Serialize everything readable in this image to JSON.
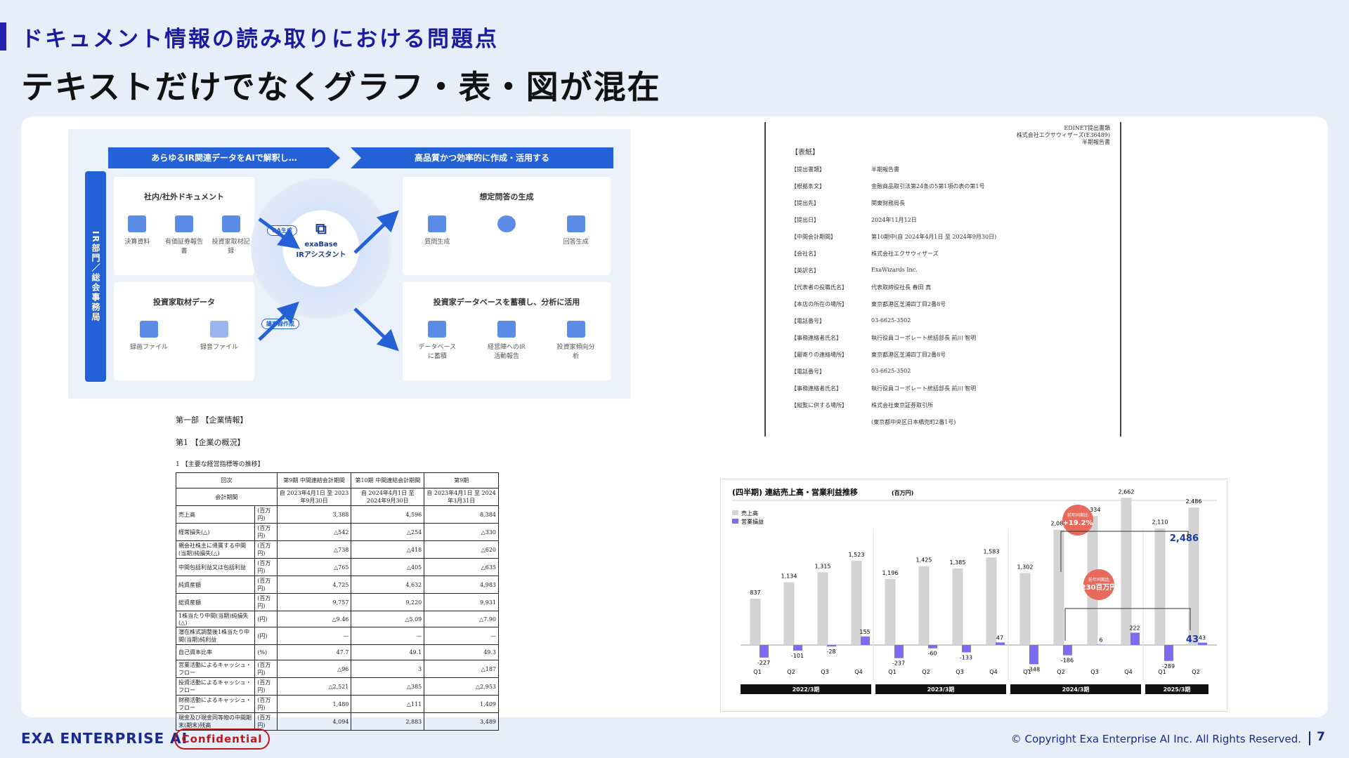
{
  "slide": {
    "subtitle": "ドキュメント情報の読み取りにおける問題点",
    "title": "テキストだけでなくグラフ・表・図が混在",
    "page": "7"
  },
  "footer": {
    "logo": "EXA ENTERPRISE AI",
    "confidential": "Confidential",
    "copyright": "© Copyright Exa Enterprise AI Inc. All Rights Reserved."
  },
  "diagram": {
    "banner_left": "あらゆるIR関連データをAIで解釈し…",
    "banner_right": "高品質かつ効率的に作成・活用する",
    "side_label": "IR部門／総会事務局",
    "box1_title": "社内/社外ドキュメント",
    "box1_items": [
      "決算資料",
      "有価証券報告書",
      "投資家取材記録"
    ],
    "box2_title": "投資家取材データ",
    "box2_items": [
      "録画ファイル",
      "録音ファイル"
    ],
    "box3_title": "想定問答の生成",
    "box3_items": [
      "質問生成",
      "回答生成"
    ],
    "box4_title": "投資家データベースを蓄積し、分析に活用",
    "box4_items": [
      "データベースに蓄積",
      "経営陣へのIR活動報告",
      "投資家傾向分析"
    ],
    "center_brand": "exaBase",
    "center_sub": "IRアシスタント",
    "pill_qa": "QA生成",
    "pill_minutes": "議事録作成"
  },
  "doc": {
    "header": [
      "EDINET提出書類",
      "株式会社エクサウィザーズ(E36489)",
      "半期報告書"
    ],
    "section": "【表紙】",
    "rows": [
      [
        "【提出書類】",
        "半期報告書"
      ],
      [
        "【根拠条文】",
        "金融商品取引法第24条の5第1項の表の第1号"
      ],
      [
        "【提出先】",
        "関東財務局長"
      ],
      [
        "【提出日】",
        "2024年11月12日"
      ],
      [
        "【中間会計期間】",
        "第10期中(自 2024年4月1日 至 2024年9月30日)"
      ],
      [
        "【会社名】",
        "株式会社エクサウィザーズ"
      ],
      [
        "【英訳名】",
        "ExaWizards Inc."
      ],
      [
        "【代表者の役職氏名】",
        "代表取締役社長 春田 真"
      ],
      [
        "【本店の所在の場所】",
        "東京都港区芝浦四丁目2番8号"
      ],
      [
        "【電話番号】",
        "03-6625-3502"
      ],
      [
        "【事務連絡者氏名】",
        "執行役員コーポレート統括部長 前川 智明"
      ],
      [
        "【最寄りの連絡場所】",
        "東京都港区芝浦四丁目2番8号"
      ],
      [
        "【電話番号】",
        "03-6625-3502"
      ],
      [
        "【事務連絡者氏名】",
        "執行役員コーポレート統括部長 前川 智明"
      ],
      [
        "【縦覧に供する場所】",
        "株式会社東京証券取引所"
      ],
      [
        "",
        "(東京都中央区日本橋兜町2番1号)"
      ]
    ]
  },
  "table_doc": {
    "part": "第一部 【企業情報】",
    "chapter": "第1 【企業の概況】",
    "section": "1 【主要な経営指標等の推移】",
    "headers": [
      "回次",
      "第9期\n中間連結会計期間",
      "第10期\n中間連結会計期間",
      "第9期"
    ],
    "period_label": "会計期間",
    "periods": [
      "自 2023年4月1日\n至 2023年9月30日",
      "自 2024年4月1日\n至 2024年9月30日",
      "自 2023年4月1日\n至 2024年3月31日"
    ],
    "rows": [
      [
        "売上高",
        "(百万円)",
        "3,388",
        "4,596",
        "8,384"
      ],
      [
        "経常損失(△)",
        "(百万円)",
        "△542",
        "△254",
        "△330"
      ],
      [
        "親会社株主に帰属する中間(当期)純損失(△)",
        "(百万円)",
        "△738",
        "△418",
        "△620"
      ],
      [
        "中間包括利益又は包括利益",
        "(百万円)",
        "△765",
        "△405",
        "△635"
      ],
      [
        "純資産額",
        "(百万円)",
        "4,725",
        "4,632",
        "4,983"
      ],
      [
        "総資産額",
        "(百万円)",
        "9,757",
        "9,220",
        "9,931"
      ],
      [
        "1株当たり中間(当期)純損失(△)",
        "(円)",
        "△9.46",
        "△5.09",
        "△7.90"
      ],
      [
        "潜在株式調整後1株当たり中間(当期)純利益",
        "(円)",
        "—",
        "—",
        "—"
      ],
      [
        "自己資本比率",
        "(%)",
        "47.7",
        "49.1",
        "49.3"
      ],
      [
        "営業活動によるキャッシュ・フロー",
        "(百万円)",
        "△96",
        "3",
        "△187"
      ],
      [
        "投資活動によるキャッシュ・フロー",
        "(百万円)",
        "△2,521",
        "△385",
        "△2,953"
      ],
      [
        "財務活動によるキャッシュ・フロー",
        "(百万円)",
        "1,480",
        "△111",
        "1,409"
      ],
      [
        "現金及び現金同等物の中間期末(期末)残高",
        "(百万円)",
        "4,094",
        "2,883",
        "3,489"
      ]
    ]
  },
  "chart_data": {
    "type": "bar",
    "title": "(四半期) 連結売上高・営業利益推移",
    "unit": "(百万円)",
    "series": [
      {
        "name": "売上高",
        "color": "#d3d3d3",
        "values": [
          837,
          1134,
          1315,
          1523,
          1196,
          1425,
          1385,
          1583,
          1302,
          2085,
          2334,
          2662,
          2110,
          2486
        ]
      },
      {
        "name": "営業損益",
        "color": "#7b6cf2",
        "values": [
          -227,
          -101,
          -28,
          155,
          -237,
          -60,
          -133,
          47,
          -348,
          -186,
          6,
          222,
          -289,
          43
        ]
      }
    ],
    "categories": [
      "Q1",
      "Q2",
      "Q3",
      "Q4",
      "Q1",
      "Q2",
      "Q3",
      "Q4",
      "Q1",
      "Q2",
      "Q3",
      "Q4",
      "Q1",
      "Q2"
    ],
    "periods": [
      "2022/3期",
      "2023/3期",
      "2024/3期",
      "2025/3期"
    ],
    "period_counts": [
      4,
      4,
      4,
      2
    ],
    "callouts": [
      {
        "label": "前年同期比",
        "value": "+19.2%"
      },
      {
        "label": "前年同期比",
        "value": "230百万円"
      }
    ],
    "accent": "#e86a5c"
  }
}
